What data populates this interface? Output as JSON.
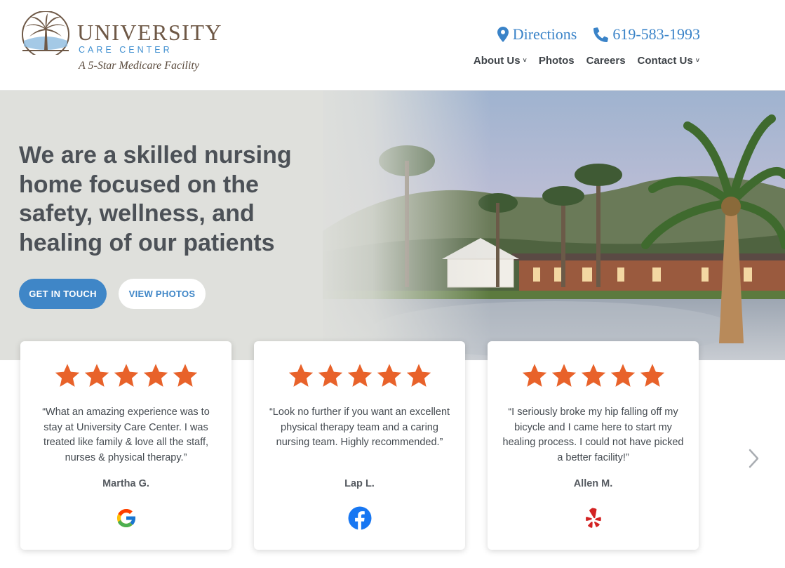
{
  "header": {
    "logo": {
      "name": "UNIVERSITY",
      "subtitle": "CARE CENTER",
      "tagline": "A 5-Star Medicare Facility"
    },
    "contact": {
      "directions_label": "Directions",
      "phone": "619-583-1993"
    },
    "nav": [
      {
        "label": "About Us",
        "has_dropdown": true
      },
      {
        "label": "Photos",
        "has_dropdown": false
      },
      {
        "label": "Careers",
        "has_dropdown": false
      },
      {
        "label": "Contact Us",
        "has_dropdown": true
      }
    ]
  },
  "hero": {
    "title": "We are a skilled nursing home focused on the safety, wellness, and healing of our patients",
    "primary_button": "GET IN TOUCH",
    "secondary_button": "VIEW PHOTOS"
  },
  "reviews": [
    {
      "rating": 5,
      "quote": "“What an amazing experience was to stay at University Care Center. I was treated like family & love all the staff, nurses & physical therapy.”",
      "author": "Martha G.",
      "source_icon": "google-icon"
    },
    {
      "rating": 5,
      "quote": "“Look no further if you want an excellent physical therapy team and a caring nursing team. Highly recommended.”",
      "author": "Lap L.",
      "source_icon": "facebook-icon"
    },
    {
      "rating": 5,
      "quote": "“I seriously broke my hip falling off my bicycle and I came here to start my healing process. I could not have picked a better facility!”",
      "author": "Allen M.",
      "source_icon": "yelp-icon"
    }
  ],
  "colors": {
    "accent_blue": "#3f86c7",
    "star_orange": "#e8622a",
    "logo_brown": "#6e5846"
  }
}
